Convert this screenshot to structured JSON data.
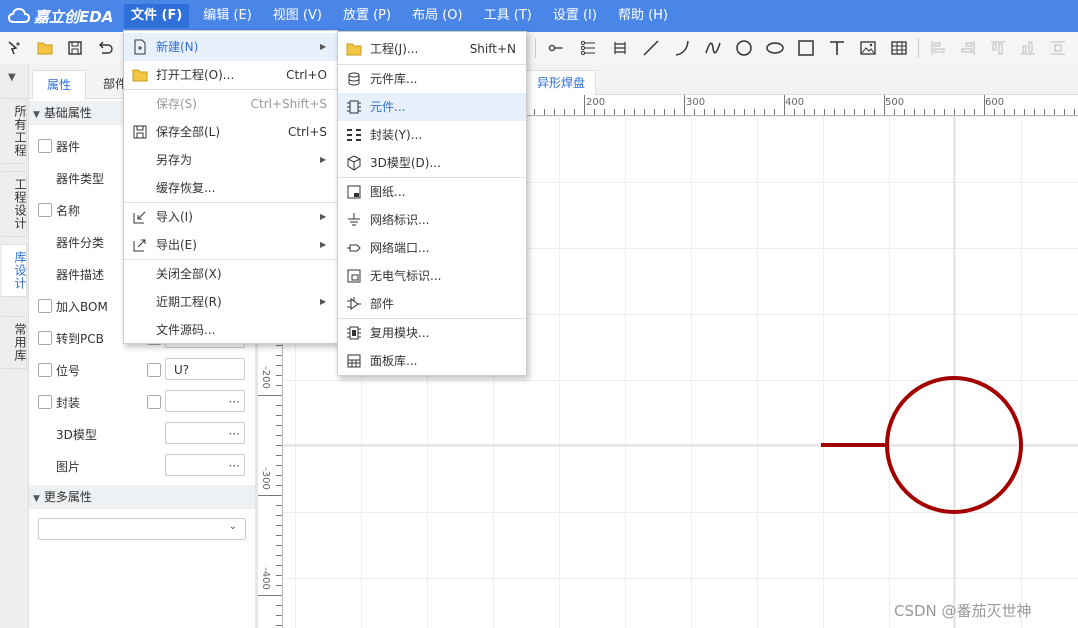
{
  "app": {
    "logo": "嘉立创EDA"
  },
  "menubar": {
    "items": [
      "文件 (F)",
      "编辑 (E)",
      "视图 (V)",
      "放置 (P)",
      "布局 (O)",
      "工具 (T)",
      "设置 (I)",
      "帮助 (H)"
    ]
  },
  "left_tabs": [
    "所有工程",
    "工程设计",
    "库设计",
    "常用库"
  ],
  "panel": {
    "tabs": [
      "属性",
      "部件"
    ],
    "section_basic": "基础属性",
    "section_more": "更多属性",
    "rows": {
      "device": "器件",
      "device_type": "器件类型",
      "name": "名称",
      "category": "器件分类",
      "desc": "器件描述",
      "bom": "加入BOM",
      "to_pcb": "转到PCB",
      "designator": "位号",
      "designator_value": "U?",
      "footprint": "封装",
      "model3d": "3D模型",
      "image": "图片"
    },
    "dots": "···"
  },
  "doc_tab": "异形焊盘",
  "ruler": {
    "h": [
      "200",
      "300",
      "400",
      "500",
      "600"
    ],
    "v": [
      "-200",
      "-300",
      "-400"
    ]
  },
  "file_menu": {
    "items": [
      {
        "label": "新建(N)",
        "shortcut": ""
      },
      {
        "label": "打开工程(O)...",
        "shortcut": "Ctrl+O"
      },
      {
        "label": "保存(S)",
        "shortcut": "Ctrl+Shift+S"
      },
      {
        "label": "保存全部(L)",
        "shortcut": "Ctrl+S"
      },
      {
        "label": "另存为",
        "shortcut": ""
      },
      {
        "label": "缓存恢复...",
        "shortcut": ""
      },
      {
        "label": "导入(I)",
        "shortcut": ""
      },
      {
        "label": "导出(E)",
        "shortcut": ""
      },
      {
        "label": "关闭全部(X)",
        "shortcut": ""
      },
      {
        "label": "近期工程(R)",
        "shortcut": ""
      },
      {
        "label": "文件源码...",
        "shortcut": ""
      }
    ]
  },
  "new_submenu": {
    "items": [
      {
        "label": "工程(J)...",
        "shortcut": "Shift+N"
      },
      {
        "label": "元件库...",
        "shortcut": ""
      },
      {
        "label": "元件...",
        "shortcut": ""
      },
      {
        "label": "封装(Y)...",
        "shortcut": ""
      },
      {
        "label": "3D模型(D)...",
        "shortcut": ""
      },
      {
        "label": "图纸...",
        "shortcut": ""
      },
      {
        "label": "网络标识...",
        "shortcut": ""
      },
      {
        "label": "网络端口...",
        "shortcut": ""
      },
      {
        "label": "无电气标识...",
        "shortcut": ""
      },
      {
        "label": "部件",
        "shortcut": ""
      },
      {
        "label": "复用模块...",
        "shortcut": ""
      },
      {
        "label": "面板库...",
        "shortcut": ""
      }
    ]
  },
  "colors": {
    "accent": "#4a86e8",
    "symbol": "#a30000"
  },
  "watermark": "CSDN @番茄灭世神"
}
